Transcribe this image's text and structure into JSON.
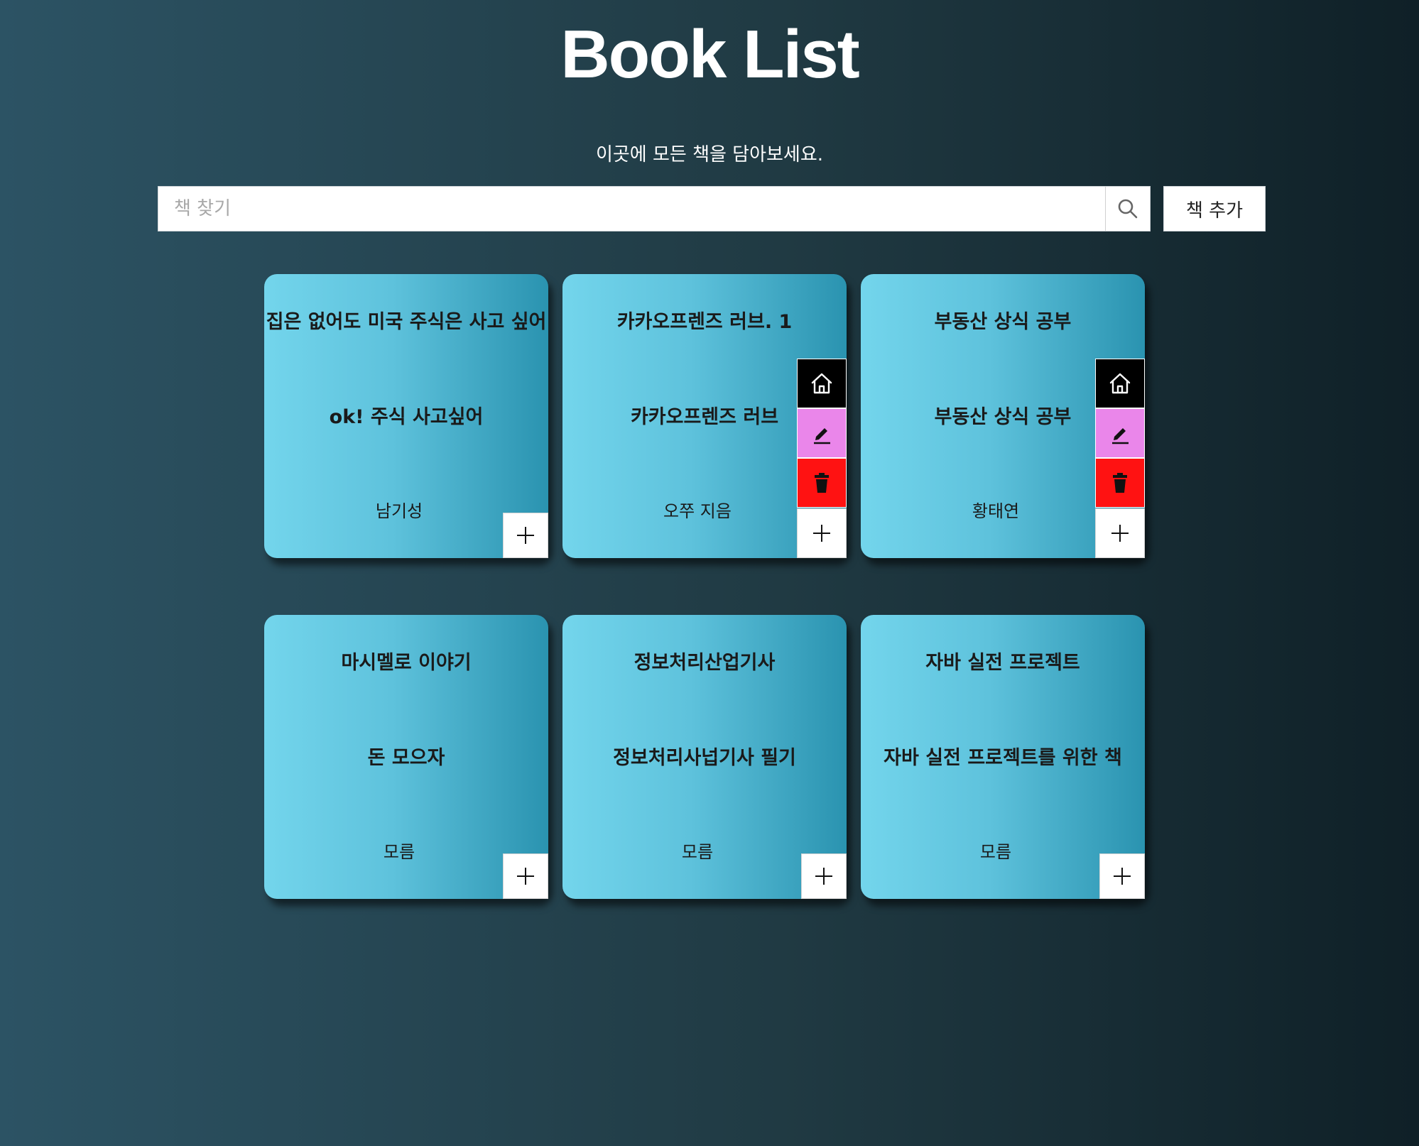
{
  "header": {
    "title": "Book List",
    "subtitle": "이곳에 모든 책을 담아보세요."
  },
  "search": {
    "placeholder": "책 찾기",
    "value": ""
  },
  "toolbar": {
    "add_book_label": "책 추가"
  },
  "books": [
    {
      "title": "집은 없어도 미국 주식은 사고 싶어",
      "subtitle": "ok! 주식 사고싶어",
      "author": "남기성",
      "actions_visible": false
    },
    {
      "title": "카카오프렌즈 러브. 1",
      "subtitle": "카카오프렌즈 러브",
      "author": "오쭈 지음",
      "actions_visible": true
    },
    {
      "title": "부동산 상식 공부",
      "subtitle": "부동산 상식 공부",
      "author": "황태연",
      "actions_visible": true
    },
    {
      "title": "마시멜로 이야기",
      "subtitle": "돈 모으자",
      "author": "모름",
      "actions_visible": false
    },
    {
      "title": "정보처리산업기사",
      "subtitle": "정보처리사넙기사 필기",
      "author": "모름",
      "actions_visible": false
    },
    {
      "title": "자바 실전 프로젝트",
      "subtitle": "자바 실전 프로젝트를 위한 책",
      "author": "모름",
      "actions_visible": false
    }
  ],
  "colors": {
    "card_gradient_start": "#73d5ec",
    "card_gradient_end": "#2a93b0",
    "home_button": "#000000",
    "edit_button": "#ea86ea",
    "delete_button": "#ff1212"
  },
  "icons": {
    "search": "search-icon",
    "plus": "plus-icon",
    "home": "home-icon",
    "edit": "pencil-icon",
    "delete": "trash-icon"
  }
}
